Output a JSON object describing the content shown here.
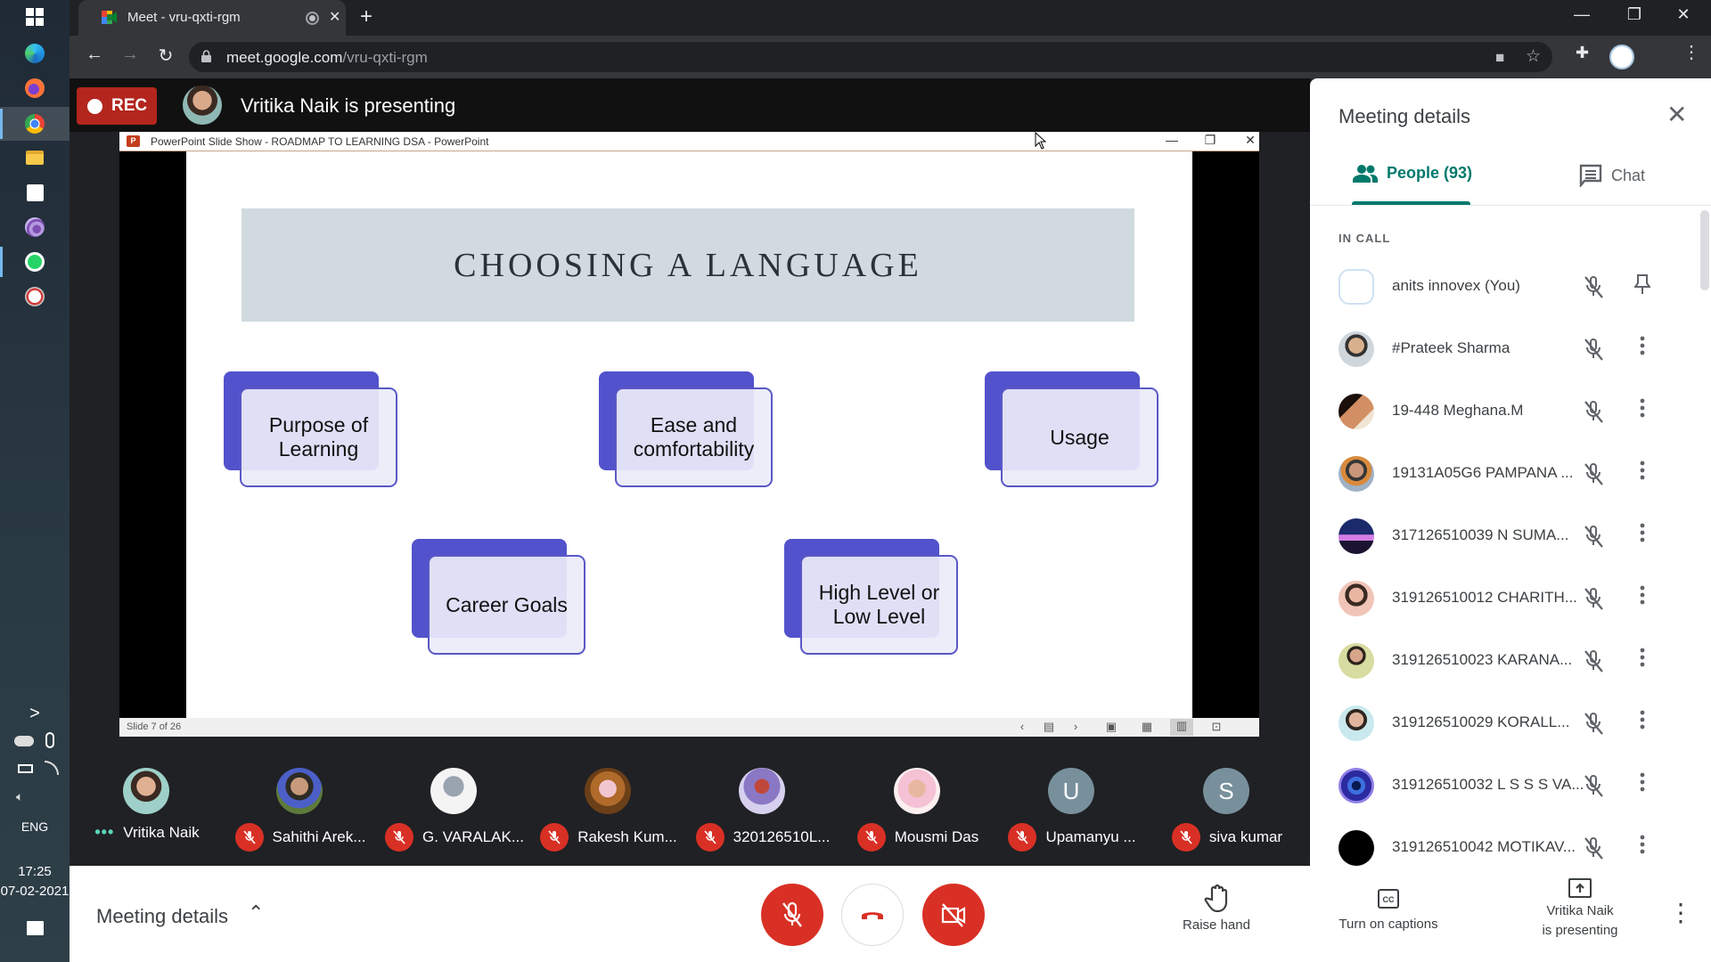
{
  "taskbar": {
    "apps": [
      {
        "name": "windows-start",
        "active": false
      },
      {
        "name": "edge",
        "active": false
      },
      {
        "name": "firefox",
        "active": false
      },
      {
        "name": "chrome",
        "active": true
      },
      {
        "name": "file-explorer",
        "active": false
      },
      {
        "name": "microsoft-store",
        "active": false
      },
      {
        "name": "tor-browser",
        "active": false
      },
      {
        "name": "whatsapp",
        "active": false
      },
      {
        "name": "snipping-tool",
        "active": false
      }
    ],
    "tray": {
      "chevron": ">",
      "language": "ENG",
      "time": "17:25",
      "date": "07-02-2021"
    }
  },
  "browser": {
    "tab_title": "Meet - vru-qxti-rgm",
    "url_domain": "meet.google.com",
    "url_path": "/vru-qxti-rgm",
    "window_controls": {
      "minimize": "—",
      "maximize": "❐",
      "close": "✕"
    }
  },
  "meet": {
    "rec_label": "REC",
    "presenter_text": "Vritika Naik is presenting",
    "ppt": {
      "window_title": "PowerPoint Slide Show  -  ROADMAP TO LEARNING DSA - PowerPoint",
      "slide_title": "CHOOSING A LANGUAGE",
      "cards": [
        {
          "label": "Purpose of Learning"
        },
        {
          "label": "Ease and comfortability"
        },
        {
          "label": "Usage"
        },
        {
          "label": "Career Goals"
        },
        {
          "label": "High Level or Low Level"
        }
      ],
      "status": "Slide 7 of 26",
      "accent_color": "#5252cc"
    },
    "filmstrip": [
      {
        "name": "Vritika Naik",
        "speaking": true,
        "muted": false,
        "avatar": "photo"
      },
      {
        "name": "Sahithi Arek...",
        "muted": true,
        "avatar": "photo"
      },
      {
        "name": "G. VARALAK...",
        "muted": true,
        "avatar": "photo"
      },
      {
        "name": "Rakesh Kum...",
        "muted": true,
        "avatar": "photo"
      },
      {
        "name": "320126510L...",
        "muted": true,
        "avatar": "photo"
      },
      {
        "name": "Mousmi Das",
        "muted": true,
        "avatar": "photo"
      },
      {
        "name": "Upamanyu ...",
        "muted": true,
        "avatar": "U"
      },
      {
        "name": "siva kumar",
        "muted": true,
        "avatar": "S"
      }
    ]
  },
  "panel": {
    "title": "Meeting details",
    "tabs": [
      {
        "label": "People (93)",
        "active": true
      },
      {
        "label": "Chat",
        "active": false
      }
    ],
    "section_label": "IN CALL",
    "people": [
      {
        "name": "anits innovex (You)",
        "action": "pin"
      },
      {
        "name": "#Prateek Sharma",
        "action": "more"
      },
      {
        "name": "19-448 Meghana.M",
        "action": "more"
      },
      {
        "name": "19131A05G6 PAMPANA ...",
        "action": "more"
      },
      {
        "name": "317126510039 N SUMA...",
        "action": "more"
      },
      {
        "name": "319126510012 CHARITH...",
        "action": "more"
      },
      {
        "name": "319126510023 KARANA...",
        "action": "more"
      },
      {
        "name": "319126510029 KORALL...",
        "action": "more"
      },
      {
        "name": "319126510032 L S S S VA...",
        "action": "more"
      },
      {
        "name": "319126510042 MOTIKAV...",
        "action": "more"
      }
    ]
  },
  "bottombar": {
    "meeting_details": "Meeting details",
    "raise_hand": "Raise hand",
    "captions": "Turn on captions",
    "presenting_line1": "Vritika Naik",
    "presenting_line2": "is presenting",
    "danger_color": "#d93025"
  }
}
